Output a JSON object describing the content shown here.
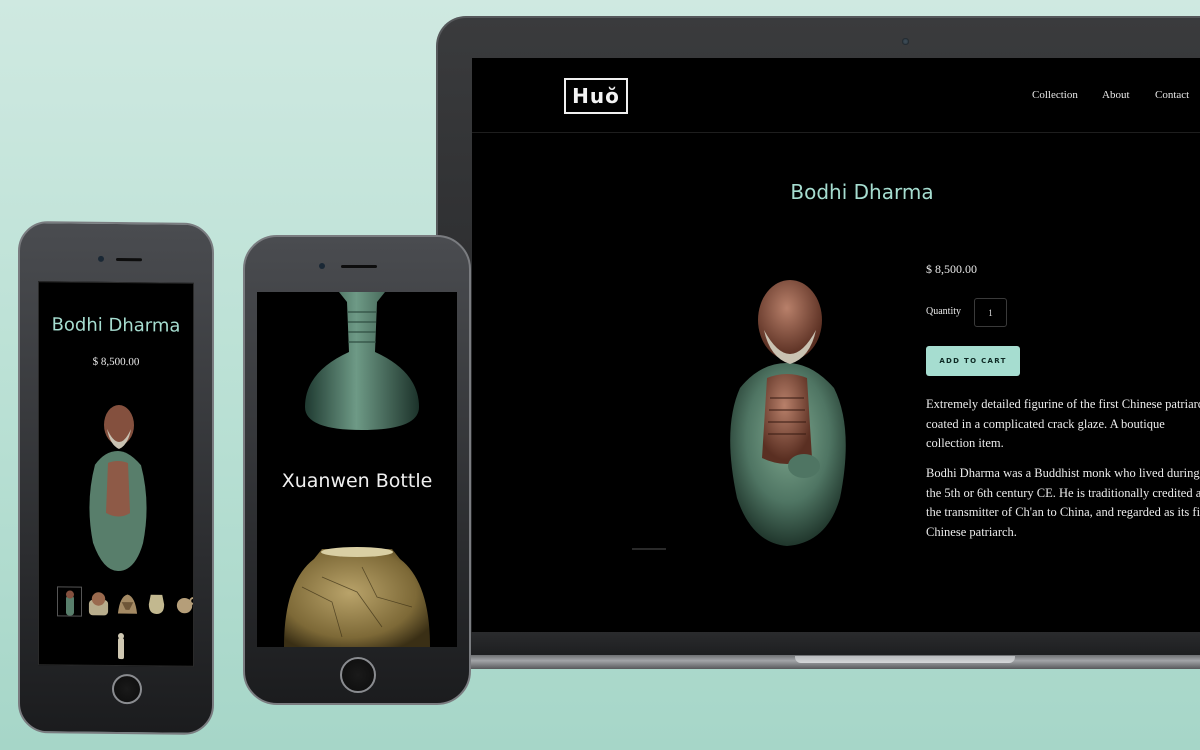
{
  "site": {
    "logo_text": "Huŏ",
    "nav": [
      "Collection",
      "About",
      "Contact"
    ]
  },
  "product": {
    "title": "Bodhi Dharma",
    "price": "$ 8,500.00",
    "quantity_label": "Quantity",
    "quantity_value": "1",
    "add_to_cart_label": "ADD TO CART",
    "description": [
      "Extremely detailed figurine of the first Chinese patriarch coated in a complicated crack glaze. A boutique collection item.",
      "Bodhi Dharma was a Buddhist monk who lived during the 5th or 6th century CE. He is traditionally credited as the transmitter of Ch'an to China, and regarded as its first Chinese patriarch."
    ]
  },
  "phone_left": {
    "title": "Bodhi Dharma",
    "price": "$ 8,500.00",
    "thumbnails": [
      "figurine-thumb",
      "figurine-closeup-thumb",
      "dragon-thumb",
      "vase-thumb",
      "teapot-thumb"
    ]
  },
  "phone_right": {
    "title": "Xuanwen Bottle"
  },
  "colors": {
    "accent": "#a6ddd0",
    "background": "#000000",
    "page_gradient": "#c3e5db"
  }
}
